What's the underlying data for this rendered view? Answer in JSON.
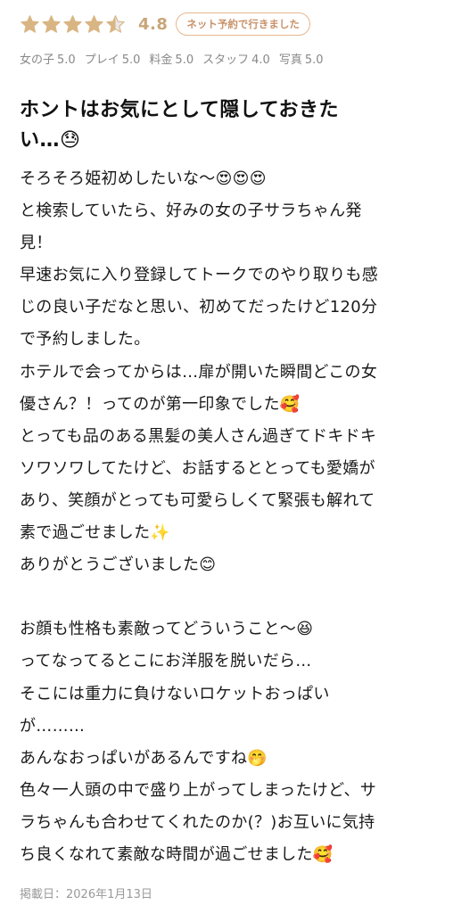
{
  "review": {
    "stars": [
      {
        "fill": 1.0
      },
      {
        "fill": 1.0
      },
      {
        "fill": 1.0
      },
      {
        "fill": 1.0
      },
      {
        "fill": 0.5
      }
    ],
    "star_color": "#d9b583",
    "star_empty_color": "#e8e8e8",
    "score": "4.8",
    "badge": "ネット予約で行きました",
    "sub_ratings": [
      {
        "label": "女の子",
        "value": "5.0"
      },
      {
        "label": "プレイ",
        "value": "5.0"
      },
      {
        "label": "料金",
        "value": "5.0"
      },
      {
        "label": "スタッフ",
        "value": "4.0"
      },
      {
        "label": "写真",
        "value": "5.0"
      }
    ],
    "title_lines": [
      "ホントはお気にとして隠しておきた",
      "い…😓"
    ],
    "body_lines": [
      "そろそろ姫初めしたいな〜😍😍😍",
      "と検索していたら、好みの女の子サラちゃん発",
      "見！",
      "早速お気に入り登録してトークでのやり取りも感",
      "じの良い子だなと思い、初めてだったけど120分",
      "で予約しました。",
      "ホテルで会ってからは…扉が開いた瞬間どこの女",
      "優さん？！ってのが第一印象でした🥰",
      "とっても品のある黒髪の美人さん過ぎてドキドキ",
      "ソワソワしてたけど、お話するととっても愛嬌が",
      "あり、笑顔がとっても可愛らしくて緊張も解れて",
      "素で過ごせました✨",
      "ありがとうございました😊",
      "",
      "お顔も性格も素敵ってどういうこと〜😆",
      "ってなってるとこにお洋服を脱いだら…",
      "そこには重力に負けないロケットおっぱい",
      "が………",
      "あんなおっぱいがあるんですね🤭",
      "色々一人頭の中で盛り上がってしまったけど、サ",
      "ラちゃんも合わせてくれたのか(？)お互いに気持",
      "ち良くなれて素敵な時間が過ごせました🥰"
    ],
    "posted": "掲載日：2026年1月13日"
  }
}
